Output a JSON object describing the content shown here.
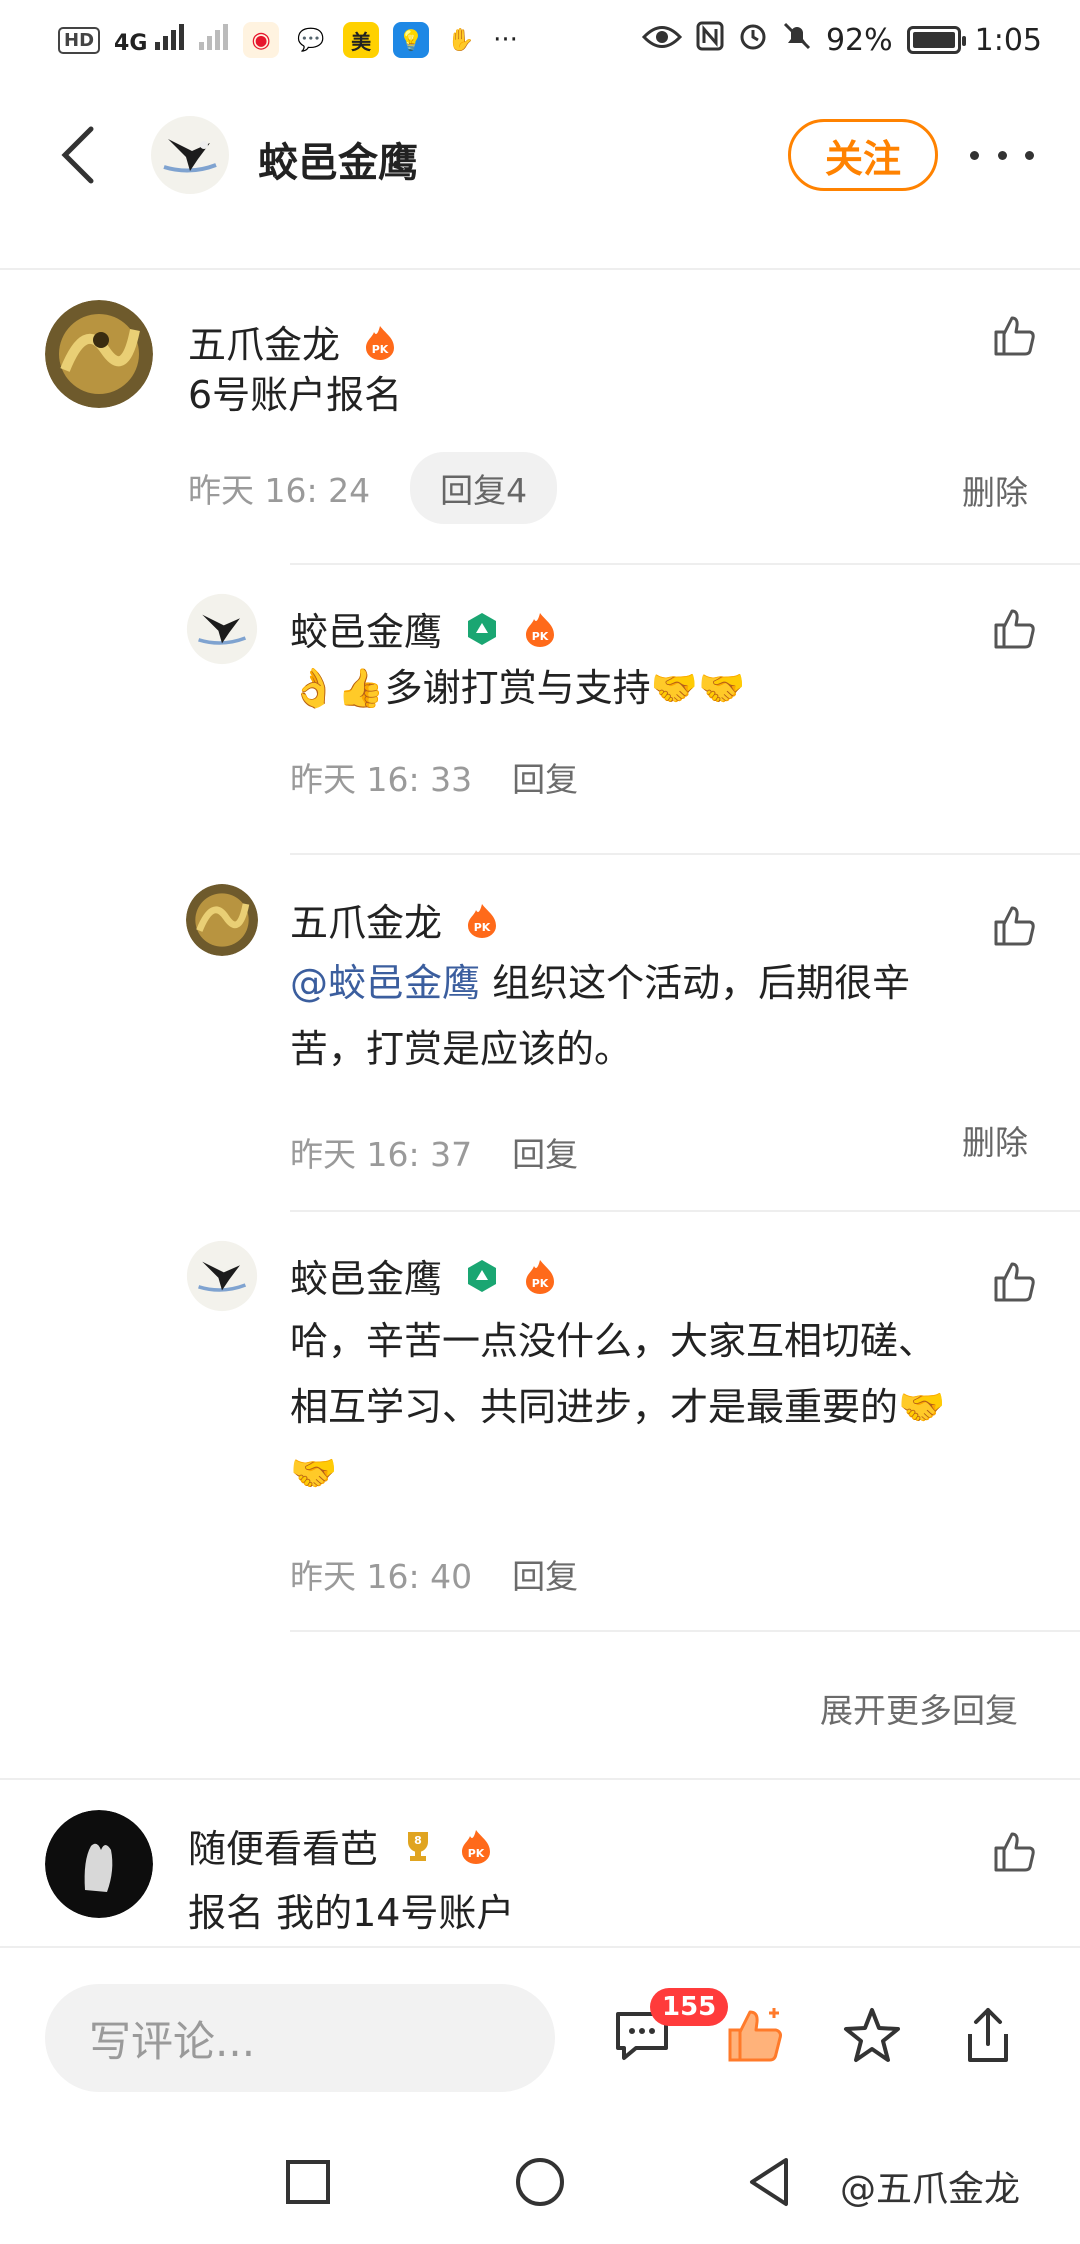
{
  "status_bar": {
    "network_badge": "HD",
    "sim_label": "4G",
    "battery": "92%",
    "time": "1:05"
  },
  "header": {
    "name": "蛟邑金鹰",
    "follow_label": "关注"
  },
  "comments": [
    {
      "name": "五爪金龙",
      "text": "6号账户报名",
      "time": "昨天 16: 24",
      "reply_label": "回复4",
      "delete_label": "删除"
    },
    {
      "name": "蛟邑金鹰",
      "text": "👌👍多谢打赏与支持🤝🤝",
      "time": "昨天 16: 33",
      "reply_label": "回复"
    },
    {
      "name": "五爪金龙",
      "mention": "@蛟邑金鹰",
      "text_line1": " 组织这个活动，后期很辛",
      "text_line2": "苦，打赏是应该的。",
      "time": "昨天 16: 37",
      "reply_label": "回复",
      "delete_label": "删除"
    },
    {
      "name": "蛟邑金鹰",
      "text_line1": "哈，辛苦一点没什么，大家互相切磋、",
      "text_line2": "相互学习、共同进步，才是最重要的🤝",
      "text_line3": "🤝",
      "time": "昨天 16: 40",
      "reply_label": "回复"
    },
    {
      "name": "随便看看芭",
      "badge_number": "8",
      "text": "报名 我的14号账户"
    }
  ],
  "expand_more_label": "展开更多回复",
  "bottom_bar": {
    "input_placeholder": "写评论...",
    "comment_count": "155"
  },
  "watermark": "@五爪金龙",
  "colors": {
    "accent": "#ff8200",
    "mention": "#3b5e9e",
    "badge_red": "#ff3b3b"
  }
}
